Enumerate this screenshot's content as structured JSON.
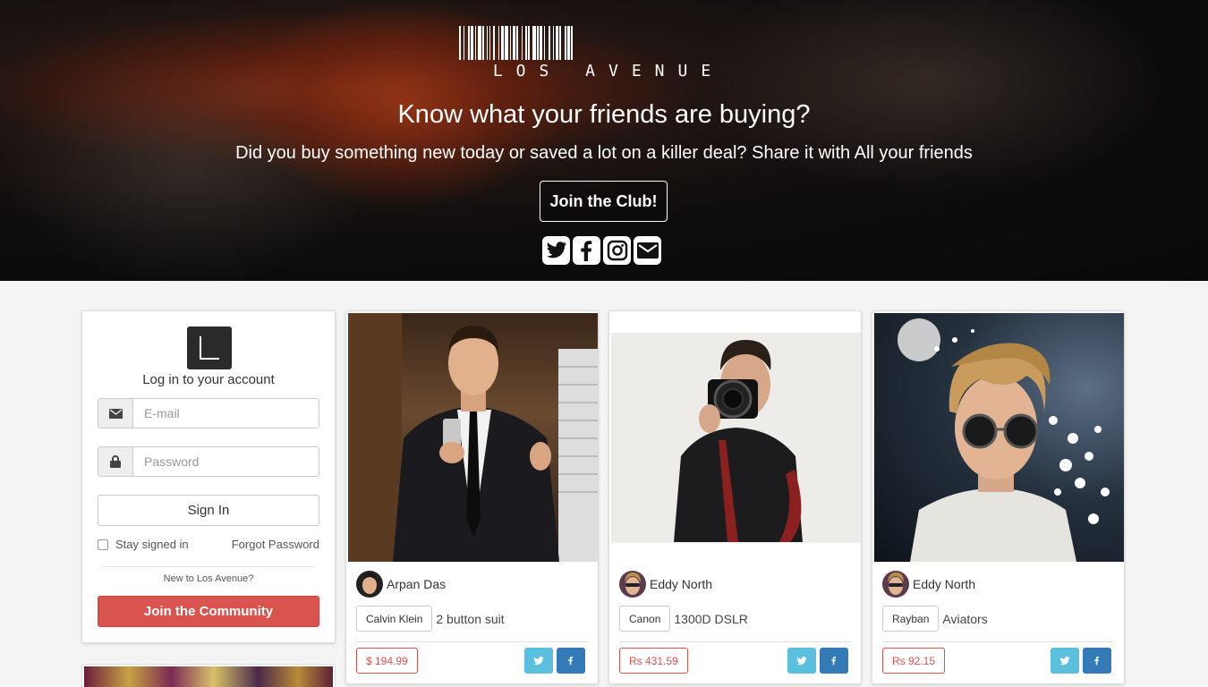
{
  "hero": {
    "logo_text": "LOS AVENUE",
    "title": "Know what your friends are buying?",
    "subtitle": "Did you buy something new today or saved a lot on a killer deal? Share it with All your friends",
    "join_label": "Join the Club!",
    "socials": [
      "twitter-icon",
      "facebook-icon",
      "instagram-icon",
      "envelope-icon"
    ]
  },
  "login": {
    "title": "Log in to your account",
    "email_placeholder": "E-mail",
    "password_placeholder": "Password",
    "signin_label": "Sign In",
    "stay_label": "Stay signed in",
    "forgot_label": "Forgot Password",
    "new_label": "New to Los Avenue?",
    "community_label": "Join the Community"
  },
  "cards": [
    {
      "user": "Arpan Das",
      "brand": "Calvin Klein",
      "item": "2 button suit",
      "price": "$ 194.99"
    },
    {
      "user": "Eddy North",
      "brand": "Canon",
      "item": "1300D DSLR",
      "price": "Rs 431.59"
    },
    {
      "user": "Eddy North",
      "brand": "Rayban",
      "item": "Aviators",
      "price": "Rs 92.15"
    }
  ],
  "colors": {
    "accent_red": "#d9534f",
    "twitter": "#5bc0de",
    "facebook": "#337ab7"
  }
}
